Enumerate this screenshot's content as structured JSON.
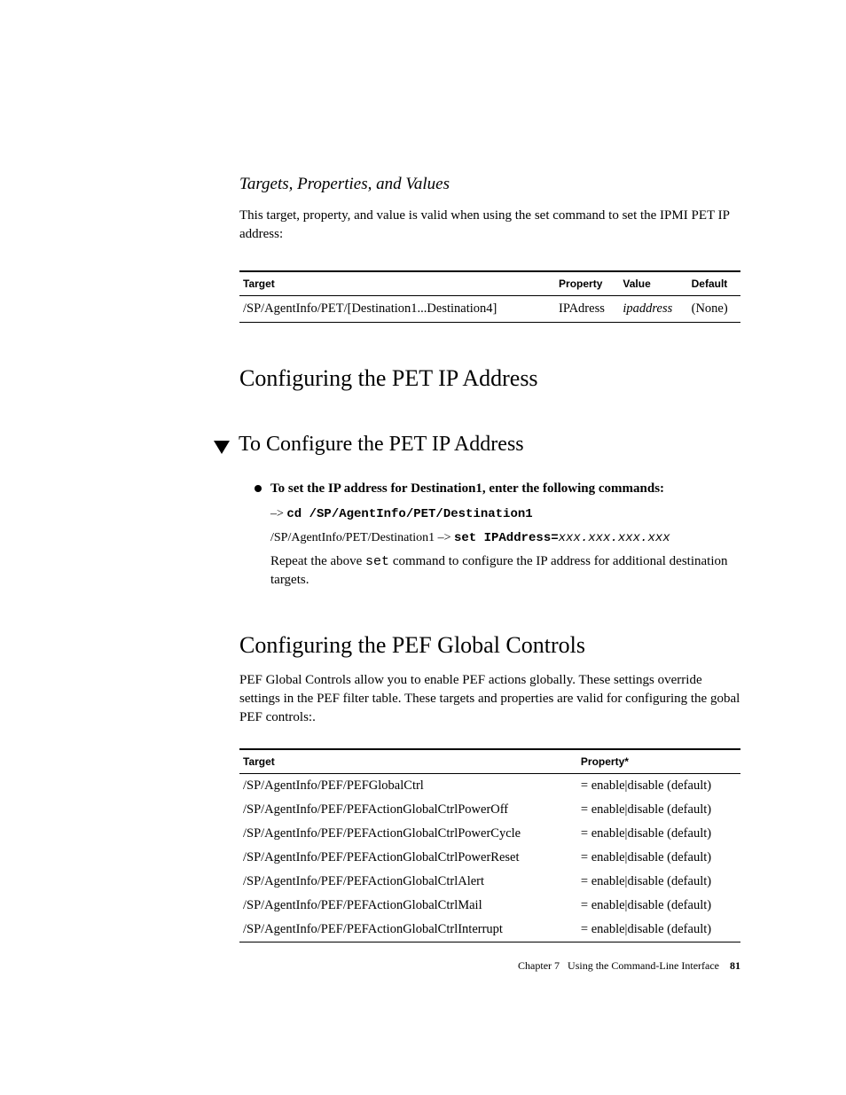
{
  "section": {
    "subheading": "Targets, Properties, and Values",
    "intro": "This target, property, and value is valid when using the set command to set the IPMI PET IP address:"
  },
  "table1": {
    "headers": {
      "c1": "Target",
      "c2": "Property",
      "c3": "Value",
      "c4": "Default"
    },
    "row": {
      "c1": "/SP/AgentInfo/PET/[Destination1...Destination4]",
      "c2": "IPAdress",
      "c3": "ipaddress",
      "c4": "(None)"
    }
  },
  "heading2a": "Configuring the PET IP Address",
  "heading3": "To Configure the PET IP Address",
  "bullet": {
    "text": "To set the IP address for Destination1, enter the following commands:",
    "cmd1_prefix": "–> ",
    "cmd1": "cd /SP/AgentInfo/PET/Destination1",
    "cmd2_prefix": "/SP/AgentInfo/PET/Destination1 –> ",
    "cmd2": "set IPAddress=",
    "cmd2_suffix": "xxx.xxx.xxx.xxx",
    "note_a": "Repeat the above ",
    "note_mono": "set",
    "note_b": " command to configure the IP address for additional destination targets."
  },
  "heading2b": "Configuring the PEF Global Controls",
  "para2": "PEF Global Controls allow you to enable PEF actions globally. These settings override settings in the PEF filter table. These targets and properties are valid for configuring the gobal PEF controls:.",
  "table2": {
    "headers": {
      "c1": "Target",
      "c2": "Property*"
    },
    "rows": [
      {
        "c1": "/SP/AgentInfo/PEF/PEFGlobalCtrl",
        "c2": "= enable|disable (default)"
      },
      {
        "c1": "/SP/AgentInfo/PEF/PEFActionGlobalCtrlPowerOff",
        "c2": "= enable|disable (default)"
      },
      {
        "c1": "/SP/AgentInfo/PEF/PEFActionGlobalCtrlPowerCycle",
        "c2": "= enable|disable (default)"
      },
      {
        "c1": "/SP/AgentInfo/PEF/PEFActionGlobalCtrlPowerReset",
        "c2": "= enable|disable (default)"
      },
      {
        "c1": "/SP/AgentInfo/PEF/PEFActionGlobalCtrlAlert",
        "c2": "= enable|disable (default)"
      },
      {
        "c1": "/SP/AgentInfo/PEF/PEFActionGlobalCtrlMail",
        "c2": "= enable|disable (default)"
      },
      {
        "c1": "/SP/AgentInfo/PEF/PEFActionGlobalCtrlInterrupt",
        "c2": "= enable|disable (default)"
      }
    ]
  },
  "footer": {
    "chapter": "Chapter 7",
    "title": "Using the Command-Line Interface",
    "page": "81"
  }
}
